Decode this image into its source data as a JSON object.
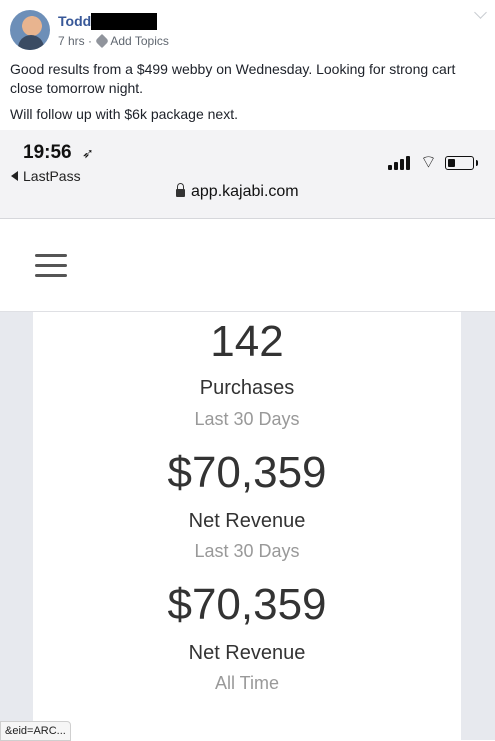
{
  "post": {
    "author_name": "Todd",
    "time_ago": "7 hrs",
    "separator": "·",
    "add_topics_label": "Add Topics",
    "text_line_1": "Good results from a $499 webby on Wednesday. Looking for strong cart close tomorrow night.",
    "text_line_2": "Will follow up with $6k package next."
  },
  "phone": {
    "status_time": "19:56",
    "location_icon": "location-arrow-icon",
    "back_app_label": "LastPass",
    "url": "app.kajabi.com"
  },
  "stats": [
    {
      "value": "142",
      "label": "Purchases",
      "period": "Last 30 Days"
    },
    {
      "value": "$70,359",
      "label": "Net Revenue",
      "period": "Last 30 Days"
    },
    {
      "value": "$70,359",
      "label": "Net Revenue",
      "period": "All Time"
    }
  ],
  "browser": {
    "status_url": "&eid=ARC..."
  },
  "colors": {
    "author_link": "#385898",
    "post_text": "#1d2129",
    "stat_text": "#333333",
    "stat_sub_text": "#999999"
  }
}
